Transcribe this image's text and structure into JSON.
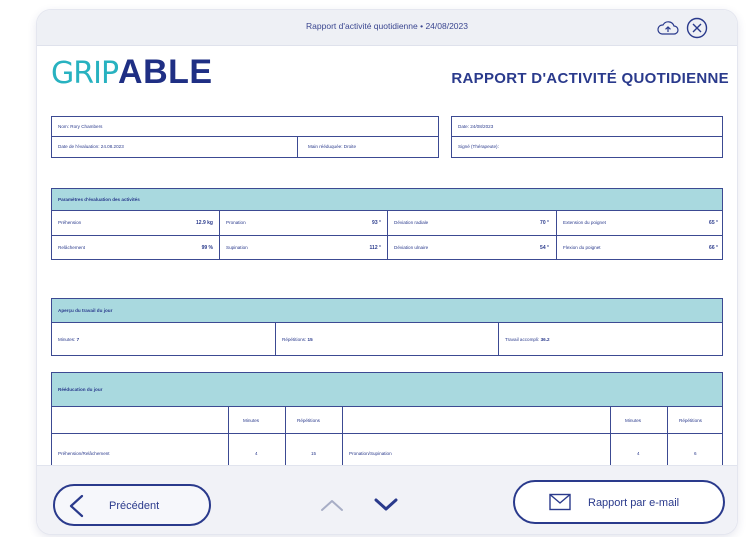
{
  "window": {
    "title": "Rapport d'activité quotidienne • 24/08/2023"
  },
  "header": {
    "logo_grip": "GRIP",
    "logo_able": "ABLE",
    "title": "RAPPORT D'ACTIVITÉ QUOTIDIENNE"
  },
  "info": {
    "name": "Nom: Rory Chambers",
    "eval_date": "Date de l'évaluation: 24.08.2023",
    "hand": "Main rééduquée: Droite",
    "date": "Date: 24/08/2023",
    "signed": "Signé (Thérapeute):"
  },
  "params": {
    "title": "Paramètres d'évaluation des activités",
    "rows": [
      [
        {
          "label": "Préhension",
          "value": "12.9 kg"
        },
        {
          "label": "Pronation",
          "value": "93 °"
        },
        {
          "label": "Déviation radiale",
          "value": "70 °"
        },
        {
          "label": "Extension du poignet",
          "value": "65 °"
        }
      ],
      [
        {
          "label": "Relâchement",
          "value": "99 %"
        },
        {
          "label": "Supination",
          "value": "112 °"
        },
        {
          "label": "Déviation ulnaire",
          "value": "54 °"
        },
        {
          "label": "Flexion du poignet",
          "value": "66 °"
        }
      ]
    ]
  },
  "overview": {
    "title": "Aperçu du travail du jour",
    "minutes_label": "Minutes:",
    "minutes_value": "7",
    "reps_label": "Répétitions:",
    "reps_value": "15",
    "work_label": "Travail accompli:",
    "work_value": "36.2"
  },
  "rehab": {
    "title": "Rééducation du jour",
    "col_minutes": "Minutes",
    "col_reps": "Répétitions",
    "rows": [
      {
        "left_label": "Préhension/Relâchement",
        "left_minutes": "4",
        "left_reps": "15",
        "right_label": "Pronation/Supination",
        "right_minutes": "4",
        "right_reps": "6"
      }
    ]
  },
  "nav": {
    "prev_label": "Précédent",
    "email_label": "Rapport par e-mail"
  },
  "colors": {
    "accent": "#28b2c0",
    "navy": "#2a3a8c",
    "header_fill": "#a9d9df"
  },
  "icons": [
    "cloud-upload-icon",
    "close-circle-icon",
    "chevron-left-icon",
    "chevron-up-icon",
    "chevron-down-icon",
    "mail-icon"
  ]
}
